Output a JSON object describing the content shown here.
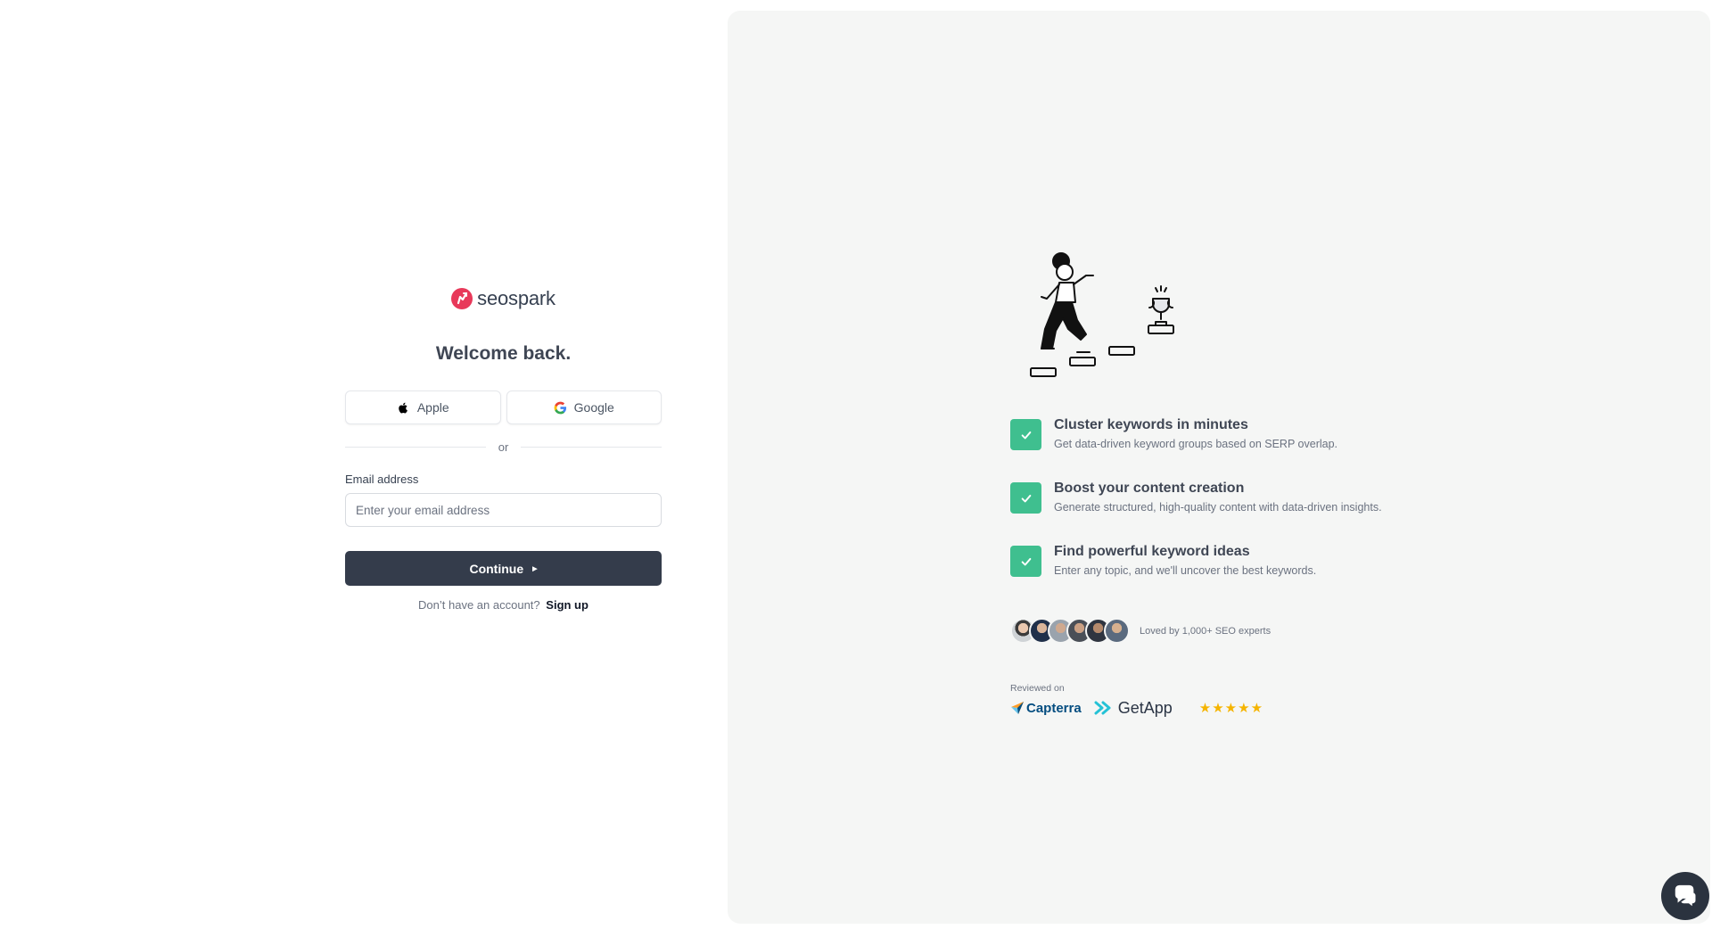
{
  "brand": {
    "name": "seospark",
    "color": "#e8395a"
  },
  "login": {
    "heading": "Welcome back.",
    "apple_label": "Apple",
    "google_label": "Google",
    "divider_text": "or",
    "email_label": "Email address",
    "email_placeholder": "Enter your email address",
    "email_value": "",
    "continue_label": "Continue",
    "signup_prompt": "Don’t have an account?",
    "signup_link": "Sign up"
  },
  "panel": {
    "features": [
      {
        "title": "Cluster keywords in minutes",
        "description": "Get data-driven keyword groups based on SERP overlap."
      },
      {
        "title": "Boost your content creation",
        "description": "Generate structured, high-quality content with data-driven insights."
      },
      {
        "title": "Find powerful keyword ideas",
        "description": "Enter any topic, and we'll uncover the best keywords."
      }
    ],
    "loved_text": "Loved by 1,000+ SEO experts",
    "reviewed_label": "Reviewed on",
    "capterra_name": "Capterra",
    "getapp_name": "GetApp",
    "rating_stars": 5
  },
  "colors": {
    "accent_green": "#3fbf8f",
    "dark_button": "#343c4b",
    "panel_bg": "#f5f6f5",
    "star": "#f5b400"
  },
  "icons": [
    "apple-icon",
    "google-icon",
    "check-icon",
    "chat-icon"
  ]
}
